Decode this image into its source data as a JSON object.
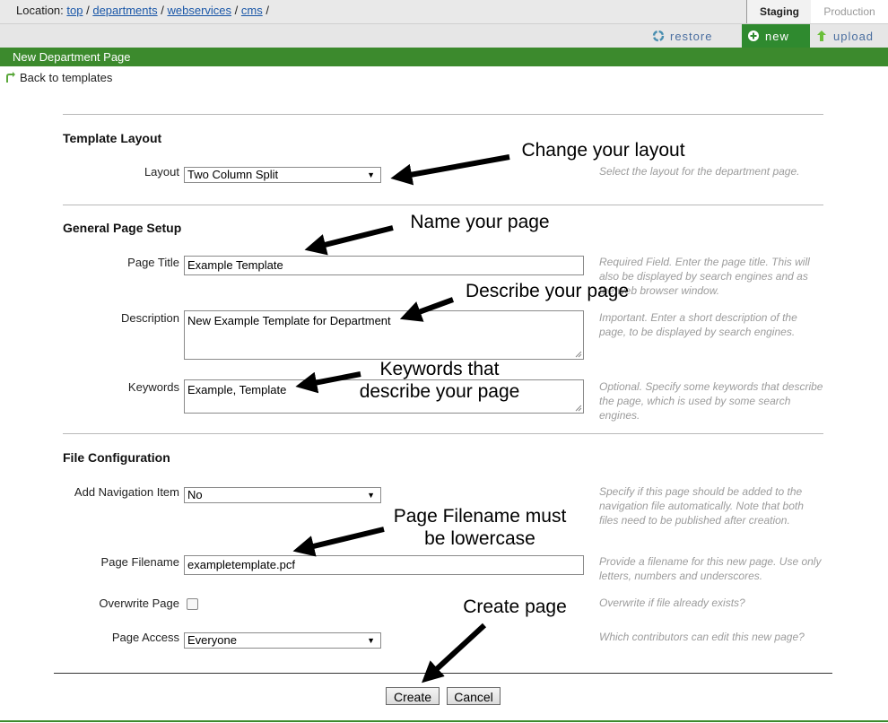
{
  "location": {
    "label": "Location:",
    "crumbs": [
      "top",
      "departments",
      "webservices",
      "cms"
    ],
    "sep": "/",
    "trail": "/"
  },
  "tabs": {
    "staging": "Staging",
    "production": "Production"
  },
  "actions": {
    "restore": "restore",
    "new": "new",
    "upload": "upload"
  },
  "page_header": "New Department Page",
  "back_link": "Back to templates",
  "sections": {
    "template_layout": "Template Layout",
    "general": "General Page Setup",
    "file_config": "File Configuration"
  },
  "fields": {
    "layout": {
      "label": "Layout",
      "value": "Two Column Split",
      "help": "Select the layout for the department page."
    },
    "page_title": {
      "label": "Page Title",
      "value": "Example Template",
      "help": "Required Field. Enter the page title. This will also be displayed by search engines and as the web browser window."
    },
    "description": {
      "label": "Description",
      "value": "New Example Template for Department",
      "help": "Important. Enter a short description of the page, to be displayed by search engines."
    },
    "keywords": {
      "label": "Keywords",
      "value": "Example, Template",
      "help": "Optional. Specify some keywords that describe the page, which is used by some search engines."
    },
    "nav_item": {
      "label": "Add Navigation Item",
      "value": "No",
      "help": "Specify if this page should be added to the navigation file automatically. Note that both files need to be published after creation."
    },
    "filename": {
      "label": "Page Filename",
      "value": "exampletemplate.pcf",
      "help": "Provide a filename for this new page. Use only letters, numbers and underscores."
    },
    "overwrite": {
      "label": "Overwrite Page",
      "checked": false,
      "help": "Overwrite if file already exists?"
    },
    "access": {
      "label": "Page Access",
      "value": "Everyone",
      "help": "Which contributors can edit this new page?"
    }
  },
  "buttons": {
    "create": "Create",
    "cancel": "Cancel"
  },
  "annotations": {
    "layout": "Change your layout",
    "name": "Name your page",
    "describe": "Describe your page",
    "keywords_1": "Keywords that",
    "keywords_2": "describe your page",
    "filename_1": "Page Filename must",
    "filename_2": "be lowercase",
    "create": "Create page"
  },
  "colors": {
    "green_bar": "#3c8a2d",
    "new_tab": "#2f8a2f",
    "link": "#1a57a8",
    "help_text": "#9c9c9c"
  }
}
